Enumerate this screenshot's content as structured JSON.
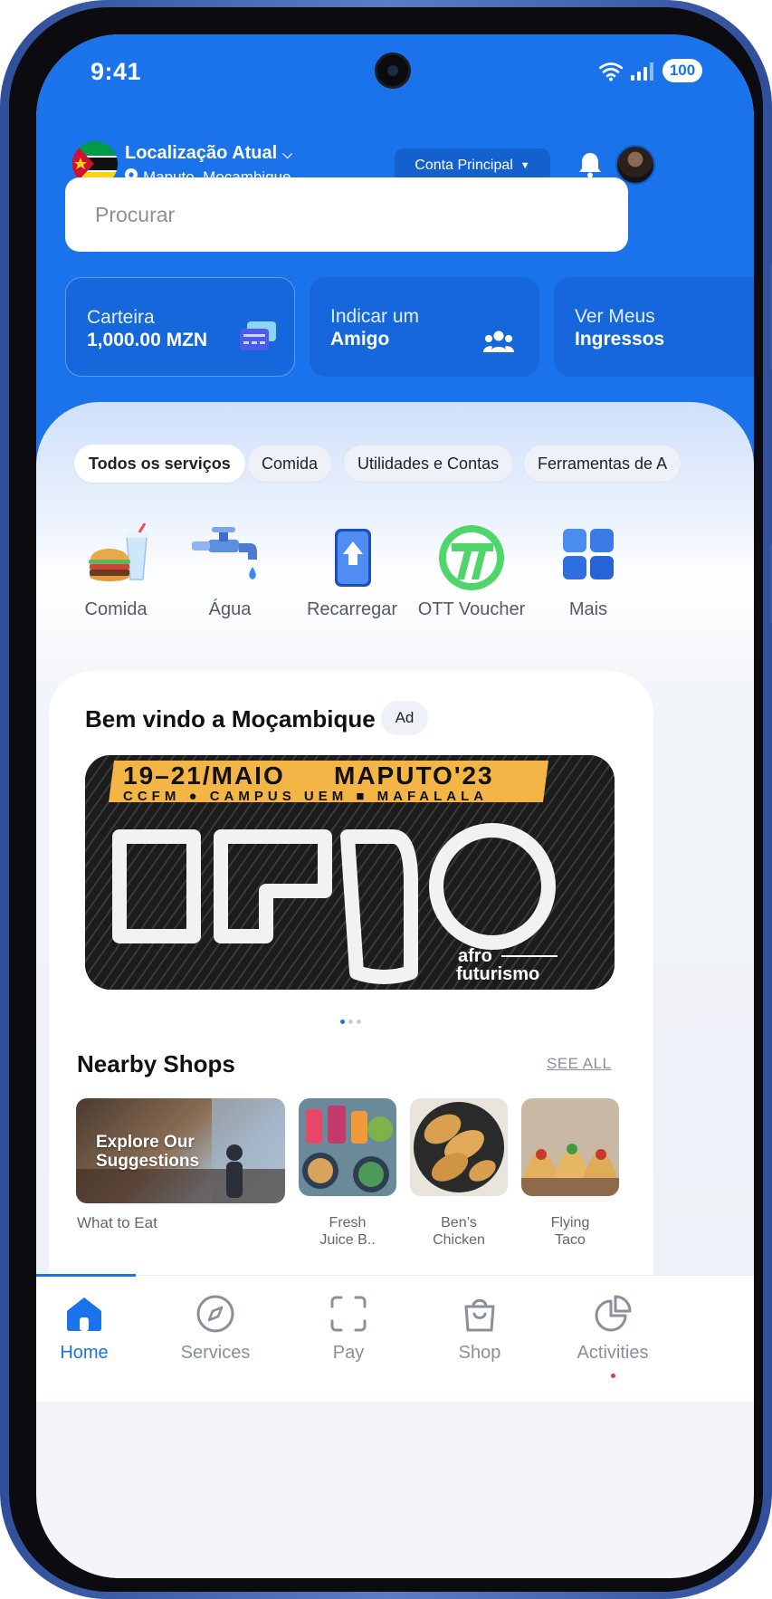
{
  "status_bar": {
    "time": "9:41",
    "battery": "100"
  },
  "header": {
    "location_title": "Localização Atual",
    "location_city": "Maputo, Moçambique",
    "account_button": "Conta Principal"
  },
  "search": {
    "placeholder": "Procurar"
  },
  "quick_cards": [
    {
      "line1": "Carteira",
      "line2": "1,000.00 MZN",
      "icon": "wallet-card-icon"
    },
    {
      "line1": "Indicar um",
      "line2": "Amigo",
      "icon": "group-icon"
    },
    {
      "line1": "Ver Meus",
      "line2": "Ingressos",
      "icon": "ticket-icon"
    }
  ],
  "chips": [
    "Todos os serviços",
    "Comida",
    "Utilidades e Contas",
    "Ferramentas de A"
  ],
  "services": [
    {
      "label": "Comida",
      "icon": "burger-drink-icon"
    },
    {
      "label": "Água",
      "icon": "water-tap-icon"
    },
    {
      "label": "Recarregar",
      "icon": "phone-topup-icon"
    },
    {
      "label": "OTT Voucher",
      "icon": "ott-logo-icon"
    },
    {
      "label": "Mais",
      "icon": "grid-icon"
    }
  ],
  "welcome": {
    "title": "Bem vindo a Moçambique",
    "ad_label": "Ad",
    "banner": {
      "dates": "19–21/MAIO",
      "city": "MAPUTO'23",
      "venue_line": "CCFM  ●  CAMPUS UEM  ■  MAFALALA",
      "logo_word": "azgo",
      "tagline_1": "afro",
      "tagline_2": "futurismo"
    },
    "carousel_pages": 3,
    "carousel_active": 1
  },
  "nearby": {
    "title": "Nearby Shops",
    "see_all": "SEE ALL",
    "explore_text": "Explore Our Suggestions",
    "explore_caption": "What to Eat",
    "shops": [
      {
        "name_1": "Fresh",
        "name_2": "Juice B.."
      },
      {
        "name_1": "Ben’s",
        "name_2": "Chicken"
      },
      {
        "name_1": "Flying",
        "name_2": "Taco"
      }
    ]
  },
  "tabbar": {
    "tabs": [
      {
        "label": "Home",
        "icon": "home-icon",
        "active": true
      },
      {
        "label": "Services",
        "icon": "compass-icon",
        "active": false
      },
      {
        "label": "Pay",
        "icon": "scan-icon",
        "active": false
      },
      {
        "label": "Shop",
        "icon": "shopping-bag-icon",
        "active": false
      },
      {
        "label": "Activities",
        "icon": "pie-chart-icon",
        "active": false
      }
    ]
  },
  "colors": {
    "primary": "#1a73ea",
    "card": "#1767dc",
    "ott_green": "#4fd66b"
  }
}
